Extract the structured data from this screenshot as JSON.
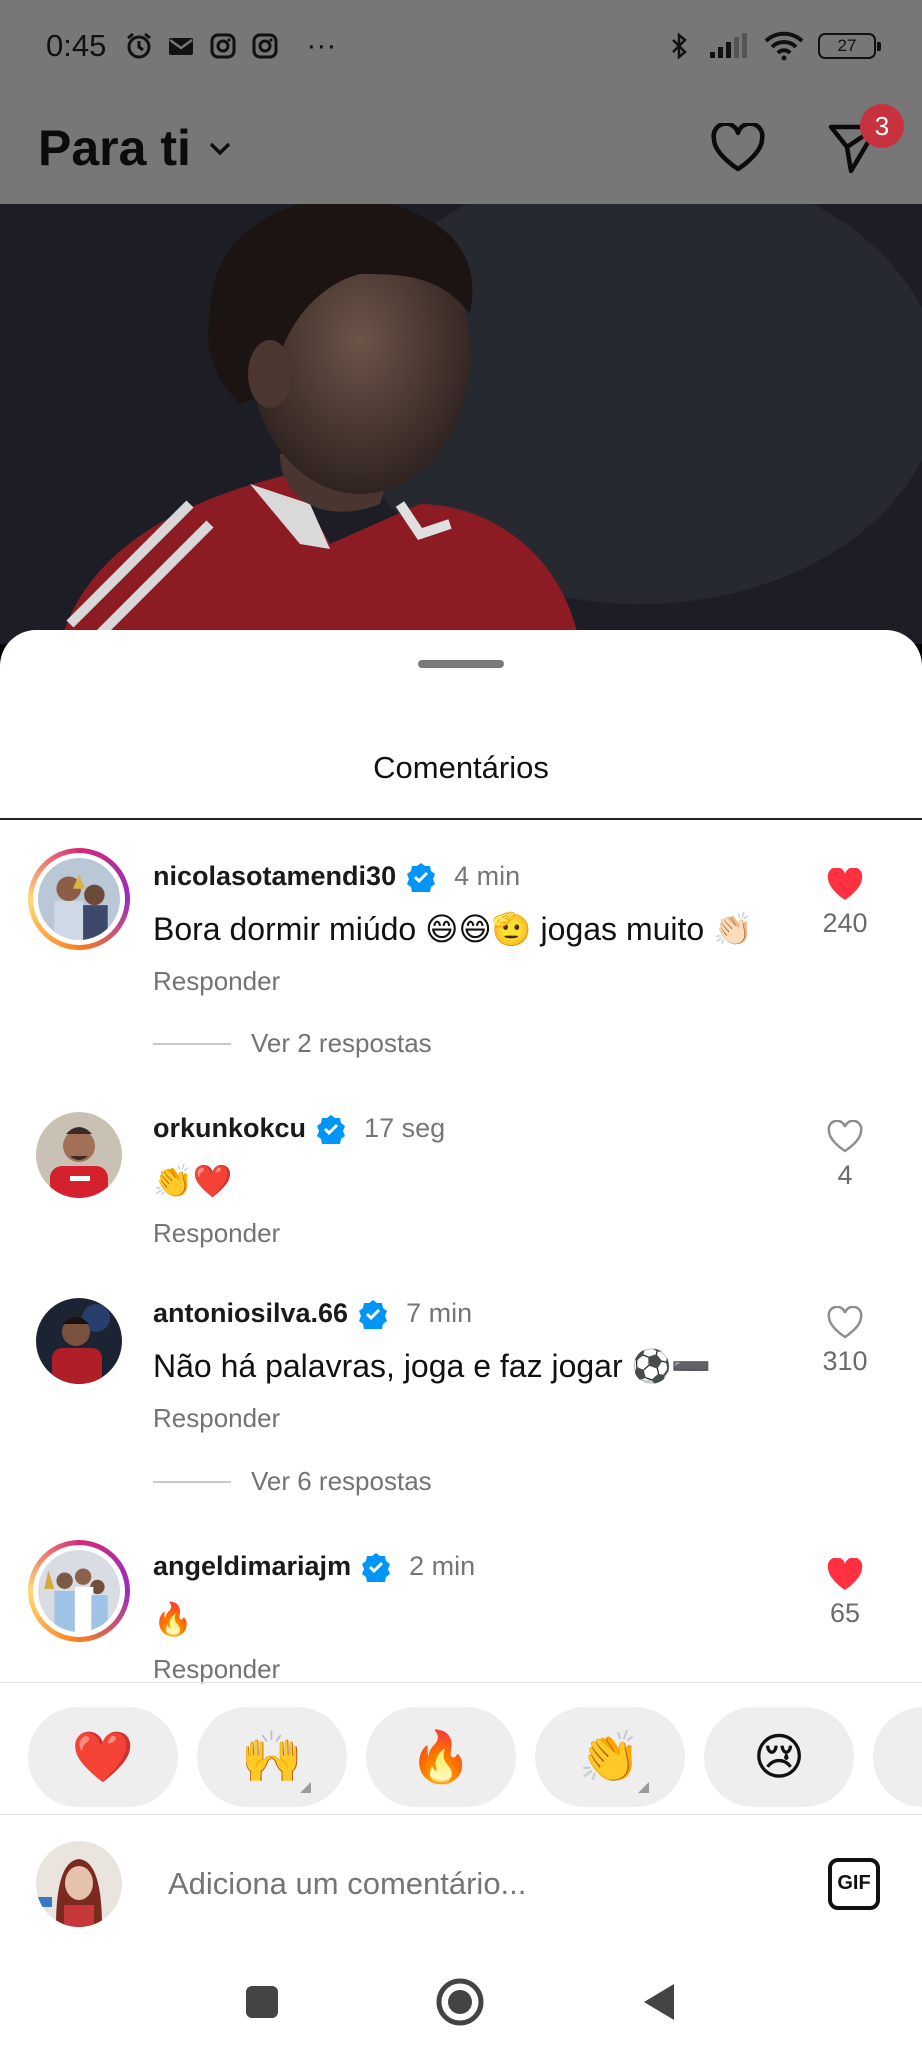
{
  "status_bar": {
    "time": "0:45",
    "icons_left": [
      "alarm-icon",
      "mail-icon",
      "instagram-icon",
      "instagram-icon"
    ],
    "more": "···",
    "icons_right": [
      "bluetooth-icon",
      "signal-icon",
      "wifi-icon"
    ],
    "battery": "27"
  },
  "header": {
    "title": "Para ti",
    "dm_badge": "3"
  },
  "sheet": {
    "title": "Comentários",
    "comments": [
      {
        "user": "nicolasotamendi30",
        "verified": true,
        "time": "4 min",
        "text": "Bora dormir miúdo 😄😄🫡 jogas muito 👏🏻",
        "reply": "Responder",
        "likes": "240",
        "liked": true
      },
      {
        "user": "orkunkokcu",
        "verified": true,
        "time": "17 seg",
        "text": "👏❤️",
        "reply": "Responder",
        "likes": "4",
        "liked": false
      },
      {
        "user": "antoniosilva.66",
        "verified": true,
        "time": "7 min",
        "text": "Não há palavras, joga e faz jogar ⚽➖",
        "reply": "Responder",
        "likes": "310",
        "liked": false
      },
      {
        "user": "angeldimariajm",
        "verified": true,
        "time": "2 min",
        "text": "🔥",
        "reply": "Responder",
        "likes": "65",
        "liked": true
      }
    ],
    "view_replies": [
      "Ver 2 respostas",
      "Ver 6 respostas"
    ]
  },
  "reactions": [
    "❤️",
    "🙌",
    "🔥",
    "👏",
    "😢"
  ],
  "composer": {
    "placeholder": "Adiciona um comentário...",
    "gif_label": "GIF"
  },
  "colors": {
    "like_red": "#ff3040",
    "verified_blue": "#0095f6",
    "badge_red": "#c8313e"
  }
}
